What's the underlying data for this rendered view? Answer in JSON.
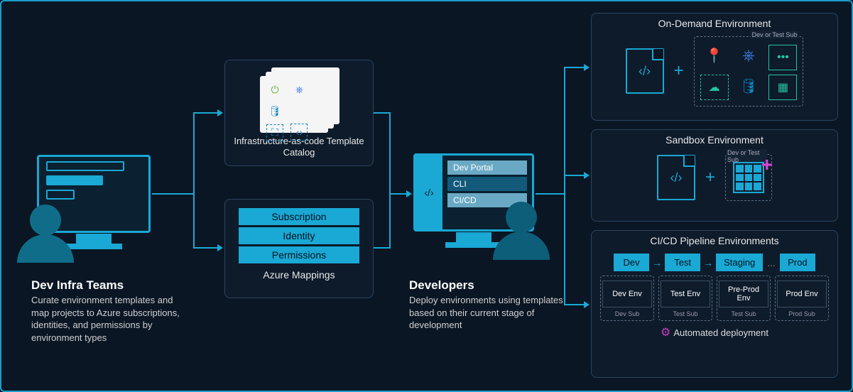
{
  "left": {
    "title": "Dev Infra Teams",
    "desc": "Curate environment templates and map projects to Azure subscriptions, identities, and permissions by environment types"
  },
  "catalog": {
    "title": "Infrastructure-as-code Template Catalog"
  },
  "mappings": {
    "title": "Azure Mappings",
    "items": [
      "Subscription",
      "Identity",
      "Permissions"
    ]
  },
  "developers": {
    "title": "Developers",
    "desc": "Deploy environments using templates based on their current stage of development",
    "list": [
      "Dev Portal",
      "CLI",
      "CI/CD"
    ]
  },
  "ondemand": {
    "title": "On-Demand Environment",
    "sublabel": "Dev or Test Sub",
    "plus": "+"
  },
  "sandbox": {
    "title": "Sandbox Environment",
    "sublabel": "Dev or Test Sub",
    "plus": "+"
  },
  "pipeline": {
    "title": "CI/CD Pipeline Environments",
    "stages": [
      "Dev",
      "Test",
      "Staging",
      "Prod"
    ],
    "envs": [
      {
        "name": "Dev Env",
        "sub": "Dev Sub"
      },
      {
        "name": "Test Env",
        "sub": "Test Sub"
      },
      {
        "name": "Pre-Prod Env",
        "sub": "Test Sub"
      },
      {
        "name": "Prod Env",
        "sub": "Prod Sub"
      }
    ],
    "auto": "Automated deployment",
    "dots": "..."
  }
}
